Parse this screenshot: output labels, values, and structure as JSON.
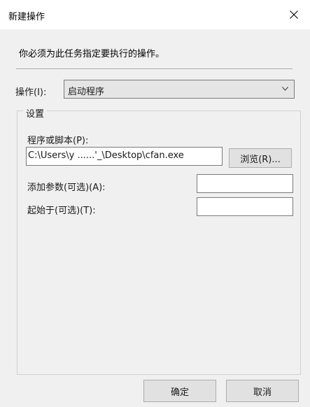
{
  "window": {
    "title": "新建操作",
    "close_icon": "close-icon"
  },
  "instruction": "你必须为此任务指定要执行的操作。",
  "action": {
    "label": "操作(I):",
    "selected": "启动程序",
    "dropdown_icon": "chevron-down-icon"
  },
  "settings": {
    "group_label": "设置",
    "program_label": "程序或脚本(P):",
    "program_value": "C:\\Users\\y ......'_\\Desktop\\cfan.exe",
    "browse_label": "浏览(R)...",
    "args_label": "添加参数(可选)(A):",
    "args_value": "",
    "startin_label": "起始于(可选)(T):",
    "startin_value": ""
  },
  "buttons": {
    "ok": "确定",
    "cancel": "取消"
  }
}
